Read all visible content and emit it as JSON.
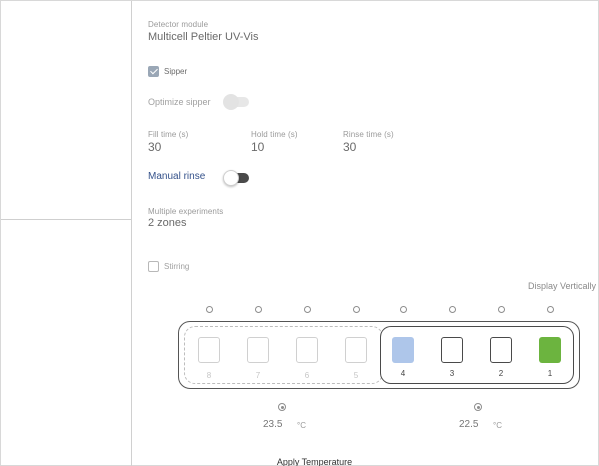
{
  "detector": {
    "label": "Detector module",
    "value": "Multicell Peltier UV-Vis"
  },
  "sipper": {
    "label": "Sipper",
    "checked": true
  },
  "optimize_sipper": {
    "label": "Optimize sipper",
    "enabled": false
  },
  "times": [
    {
      "label": "Fill time (s)",
      "value": "30"
    },
    {
      "label": "Hold time (s)",
      "value": "10"
    },
    {
      "label": "Rinse time (s)",
      "value": "30"
    }
  ],
  "manual_rinse": {
    "label": "Manual rinse",
    "on": false
  },
  "experiments": {
    "label": "Multiple experiments",
    "value": "2 zones"
  },
  "stirring": {
    "label": "Stirring",
    "checked": false
  },
  "display_toggle": {
    "label": "Display Vertically"
  },
  "cells": [
    {
      "number": "8",
      "active": false,
      "color": "#ffffff"
    },
    {
      "number": "7",
      "active": false,
      "color": "#ffffff"
    },
    {
      "number": "6",
      "active": false,
      "color": "#ffffff"
    },
    {
      "number": "5",
      "active": false,
      "color": "#ffffff"
    },
    {
      "number": "4",
      "active": true,
      "color": "#aec6ea"
    },
    {
      "number": "3",
      "active": true,
      "color": "#ffffff"
    },
    {
      "number": "2",
      "active": true,
      "color": "#ffffff"
    },
    {
      "number": "1",
      "active": true,
      "color": "#6cb43f"
    }
  ],
  "zones": [
    {
      "temperature": "23.5",
      "unit": "°C",
      "icon": "thermometer-icon"
    },
    {
      "temperature": "22.5",
      "unit": "°C",
      "icon": "thermometer-icon"
    }
  ],
  "apply_button": {
    "label": "Apply Temperature"
  }
}
